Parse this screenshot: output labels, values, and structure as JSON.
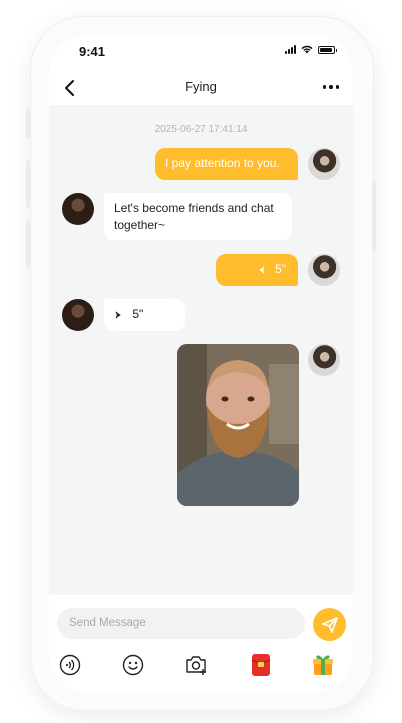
{
  "status_bar": {
    "time": "9:41"
  },
  "header": {
    "title": "Fying"
  },
  "chat": {
    "timestamp": "2025-06-27 17:41:14",
    "messages": [
      {
        "from": "me",
        "type": "text",
        "text": "I pay attention to you."
      },
      {
        "from": "contact",
        "type": "text",
        "text": "Let's become friends and chat together~"
      },
      {
        "from": "me",
        "type": "voice",
        "duration": "5\""
      },
      {
        "from": "contact",
        "type": "voice",
        "duration": "5\""
      },
      {
        "from": "me",
        "type": "image"
      }
    ]
  },
  "composer": {
    "placeholder": "Send Message"
  },
  "toolbar": {
    "icons": [
      "voice-icon",
      "emoji-icon",
      "camera-icon",
      "red-envelope-icon",
      "gift-icon"
    ]
  },
  "colors": {
    "accent": "#ffbc2d",
    "background": "#f4f5f5",
    "bubble_in": "#ffffff"
  }
}
